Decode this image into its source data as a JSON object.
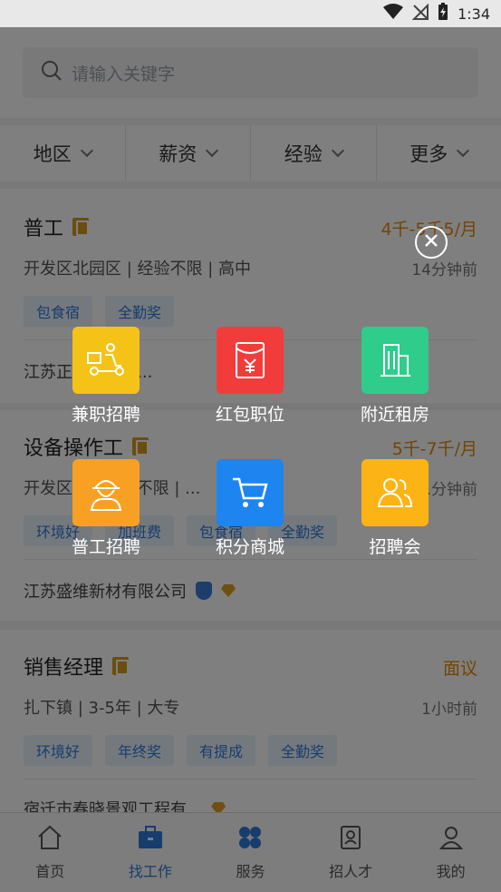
{
  "status_bar": {
    "time": "1:34"
  },
  "search": {
    "placeholder": "请输入关键字"
  },
  "filters": [
    {
      "label": "地区"
    },
    {
      "label": "薪资"
    },
    {
      "label": "经验"
    },
    {
      "label": "更多"
    }
  ],
  "jobs": [
    {
      "title": "普工",
      "salary": "4千-5千5/月",
      "meta": "开发区北园区 | 经验不限 | 高中",
      "time": "14分钟前",
      "tags": [
        "包食宿",
        "全勤奖"
      ],
      "company": "江苏正...产业有..."
    },
    {
      "title": "设备操作工",
      "salary": "5千-7千/月",
      "meta": "开发区... | 经验不限 | ...",
      "time": "...分钟前",
      "tags": [
        "环境好",
        "加班费",
        "包食宿",
        "全勤奖"
      ],
      "company": "江苏盛维新材有限公司"
    },
    {
      "title": "销售经理",
      "salary": "面议",
      "meta": "扎下镇 | 3-5年 | 大专",
      "time": "1小时前",
      "tags": [
        "环境好",
        "年终奖",
        "有提成",
        "全勤奖"
      ],
      "company": "宿迁市春晓景观工程有..."
    }
  ],
  "services": [
    {
      "label": "兼职招聘",
      "color": "#f5c218",
      "icon": "delivery-scooter-icon"
    },
    {
      "label": "红包职位",
      "color": "#f23c3c",
      "icon": "red-envelope-icon"
    },
    {
      "label": "附近租房",
      "color": "#2fcc8b",
      "icon": "building-icon"
    },
    {
      "label": "普工招聘",
      "color": "#f8a024",
      "icon": "worker-helmet-icon"
    },
    {
      "label": "积分商城",
      "color": "#1e84f0",
      "icon": "shopping-cart-icon"
    },
    {
      "label": "招聘会",
      "color": "#fcb415",
      "icon": "group-people-icon"
    }
  ],
  "tabs": [
    {
      "label": "首页",
      "icon": "home-icon"
    },
    {
      "label": "找工作",
      "icon": "briefcase-icon",
      "active": true
    },
    {
      "label": "服务",
      "icon": "clover-icon"
    },
    {
      "label": "招人才",
      "icon": "resume-icon"
    },
    {
      "label": "我的",
      "icon": "person-icon"
    }
  ],
  "colors": {
    "accent": "#2f7bd8",
    "salary": "#e68a00"
  }
}
